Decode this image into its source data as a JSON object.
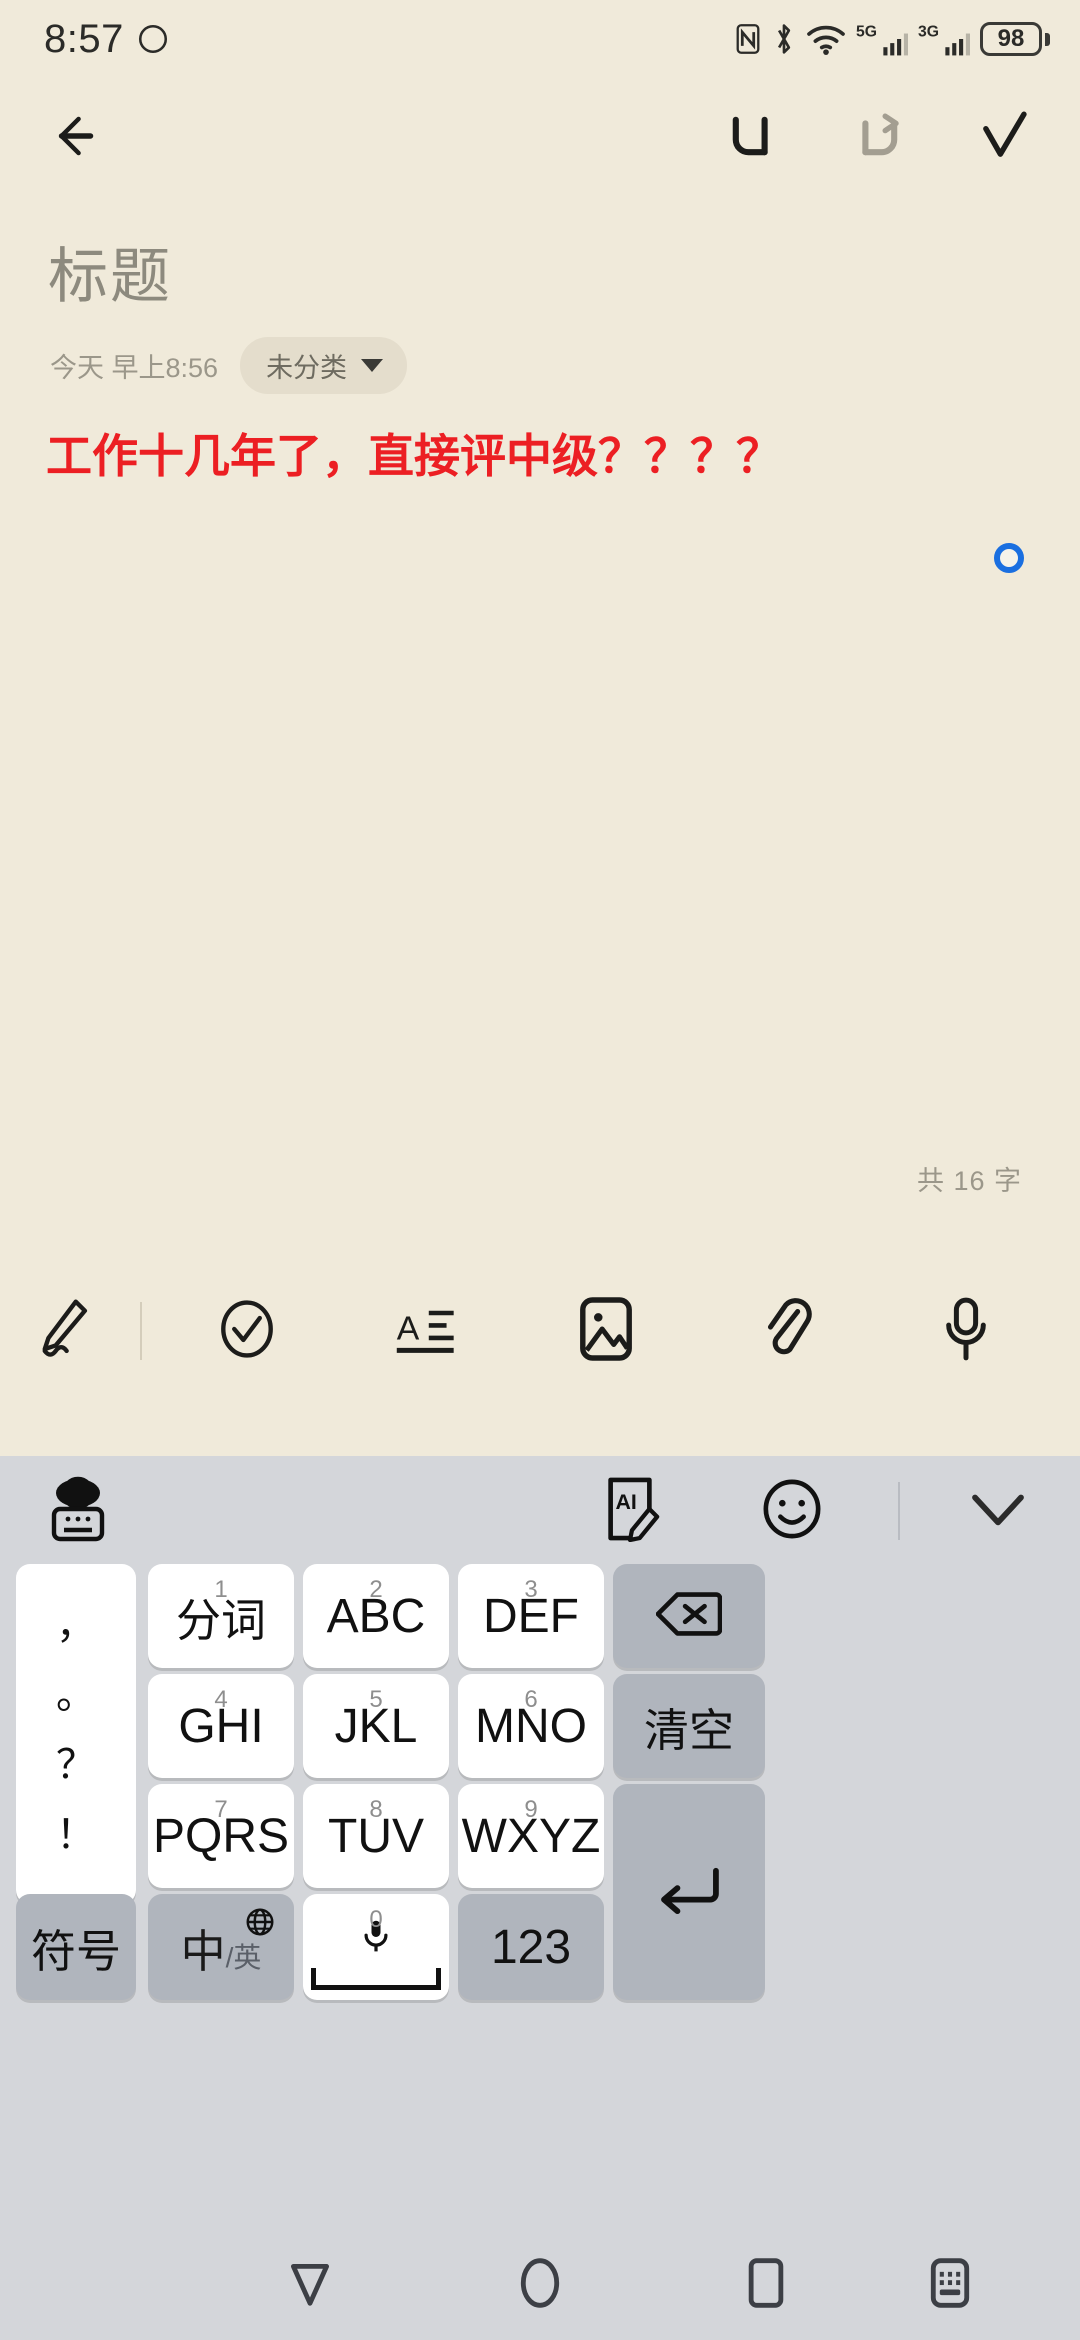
{
  "status_bar": {
    "time": "8:57",
    "eye_icon": "eye-comfort-icon",
    "icons": [
      "nfc-icon",
      "bluetooth-icon",
      "wifi-icon"
    ],
    "sim1_network": "5G",
    "sim2_network": "3G",
    "battery_percent": "98"
  },
  "header": {
    "back_icon": "back-arrow-icon",
    "undo_icon": "undo-icon",
    "redo_icon": "redo-icon",
    "done_icon": "checkmark-icon",
    "undo_color": "#1c1c1a",
    "redo_color": "#a39e91"
  },
  "note": {
    "title_placeholder": "标题",
    "date": "今天 早上8:56",
    "category": "未分类",
    "category_caret": "chevron-down-icon",
    "body_text": "工作十几年了，直接评中级？？？？",
    "body_color": "#ec1f23",
    "word_count": "共 16 字",
    "cursor_handle": "text-cursor-handle"
  },
  "editor_toolbar": {
    "items": [
      {
        "name": "handwriting-pen-icon",
        "label": "手写"
      },
      {
        "name": "toolbar-divider",
        "label": ""
      },
      {
        "name": "checklist-icon",
        "label": "待办"
      },
      {
        "name": "text-format-icon",
        "label": "格式"
      },
      {
        "name": "image-icon",
        "label": "图片"
      },
      {
        "name": "attachment-icon",
        "label": "附件"
      },
      {
        "name": "microphone-icon",
        "label": "录音"
      }
    ]
  },
  "keyboard": {
    "top_bar": {
      "language_switch_icon": "globe-keyboard-icon",
      "ai_write_icon": "ai-write-icon",
      "emoji_icon": "emoji-smiley-icon",
      "divider": "keyboard-divider",
      "collapse_icon": "chevron-down-collapse-icon"
    },
    "punctuation_key": [
      "，",
      "。",
      "？",
      "！"
    ],
    "rows": [
      [
        {
          "num": "1",
          "label": "分词",
          "style": "white",
          "name": "key-fenci"
        },
        {
          "num": "2",
          "label": "ABC",
          "style": "white",
          "name": "key-abc"
        },
        {
          "num": "3",
          "label": "DEF",
          "style": "white",
          "name": "key-def"
        }
      ],
      [
        {
          "num": "4",
          "label": "GHI",
          "style": "white",
          "name": "key-ghi"
        },
        {
          "num": "5",
          "label": "JKL",
          "style": "white",
          "name": "key-jkl"
        },
        {
          "num": "6",
          "label": "MNO",
          "style": "white",
          "name": "key-mno"
        }
      ],
      [
        {
          "num": "7",
          "label": "PQRS",
          "style": "white",
          "name": "key-pqrs"
        },
        {
          "num": "8",
          "label": "TUV",
          "style": "white",
          "name": "key-tuv"
        },
        {
          "num": "9",
          "label": "WXYZ",
          "style": "white",
          "name": "key-wxyz"
        }
      ]
    ],
    "backspace_icon": "backspace-icon",
    "clear_label": "清空",
    "enter_icon": "enter-return-icon",
    "symbol_label": "符号",
    "lang_main": "中",
    "lang_sub": "/英",
    "lang_globe_icon": "globe-icon",
    "space_num": "0",
    "space_mic_icon": "microphone-icon",
    "numeric_label": "123"
  },
  "nav_bar": {
    "back_icon": "nav-back-triangle-icon",
    "home_icon": "nav-home-circle-icon",
    "recents_icon": "nav-recents-square-icon",
    "hide_keyboard_icon": "hide-keyboard-icon"
  },
  "colors": {
    "paper": "#f0eada",
    "keyboard_bg": "#d4d6da",
    "key_white": "#ffffff",
    "key_gray": "#b0b5bd",
    "accent_red": "#ec1f23",
    "cursor_blue": "#1a6fe0"
  }
}
